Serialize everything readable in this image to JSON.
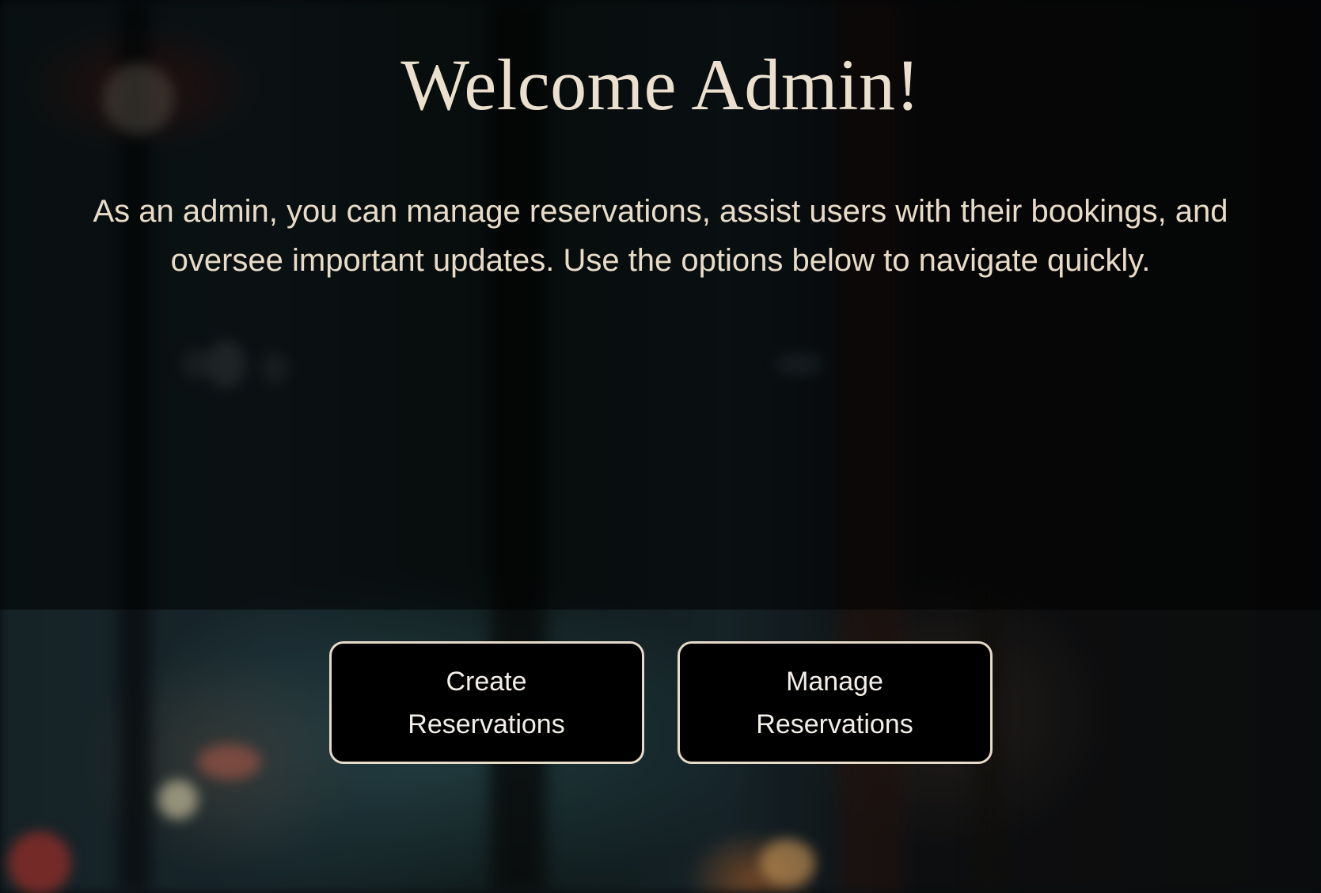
{
  "header": {
    "title": "Welcome Admin!"
  },
  "intro": {
    "text": "As an admin, you can manage reservations, assist users with their bookings, and oversee important updates. Use the options below to navigate quickly."
  },
  "actions": {
    "create_label": "Create Reservations",
    "manage_label": "Manage Reservations"
  },
  "colors": {
    "text_cream": "#ebe0cd",
    "button_bg": "#000000",
    "button_border": "#e6dac8"
  }
}
